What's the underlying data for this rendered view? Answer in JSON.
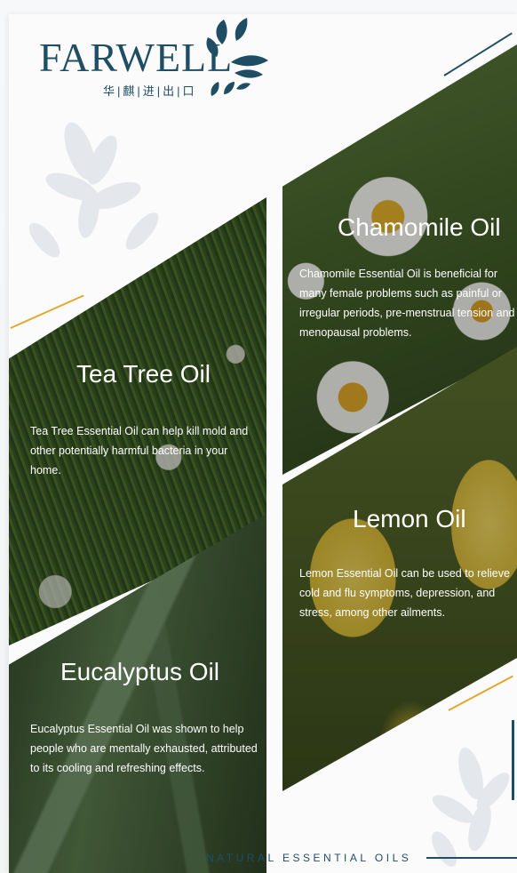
{
  "brand": {
    "name": "FARWELL",
    "subtitle": "华|麒|进|出|口"
  },
  "products": {
    "tea_tree": {
      "title": "Tea Tree Oil",
      "description": "Tea Tree Essential Oil can help kill mold and other potentially harmful bacteria in your home."
    },
    "chamomile": {
      "title": "Chamomile Oil",
      "description": "Chamomile Essential Oil is beneficial for many female problems such as painful or irregular periods, pre-menstrual tension and menopausal problems."
    },
    "lemon": {
      "title": "Lemon Oil",
      "description": "Lemon Essential Oil can be used to relieve cold and flu symptoms, depression, and stress, among other ailments."
    },
    "eucalyptus": {
      "title": "Eucalyptus Oil",
      "description": "Eucalyptus Essential Oil was shown to help people who are mentally exhausted, attributed to its cooling and refreshing effects."
    }
  },
  "footer": {
    "tagline": "NATURAL ESSENTIAL OILS"
  },
  "colors": {
    "brand": "#1f4e64",
    "accent": "#e2a82a"
  },
  "icons": {
    "logo": "leaf-cluster-icon",
    "background": "flower-silhouette-icon"
  }
}
